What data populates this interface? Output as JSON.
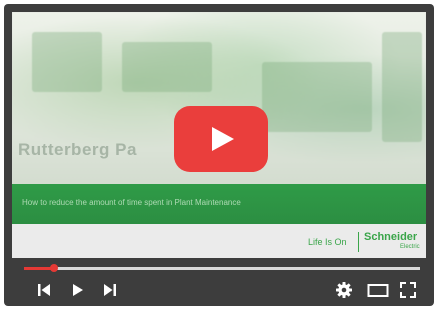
{
  "video": {
    "title_overlay": "Rutterberg Pa",
    "subtitle_band": "How to reduce the amount of time spent in Plant Maintenance",
    "tagline": "Life Is On",
    "brand_name": "Schneider",
    "brand_sub": "Electric",
    "brand_color": "#3aa54a",
    "band_color": "#2f9b47"
  },
  "play_button": {
    "icon": "play-icon",
    "color": "#ea3e3c"
  },
  "controls": {
    "progress_fraction": 0.075,
    "progress_color": "#e53935",
    "icons": [
      "skip-previous-icon",
      "play-icon",
      "skip-next-icon",
      "settings-gear-icon",
      "theater-mode-icon",
      "fullscreen-icon"
    ]
  }
}
